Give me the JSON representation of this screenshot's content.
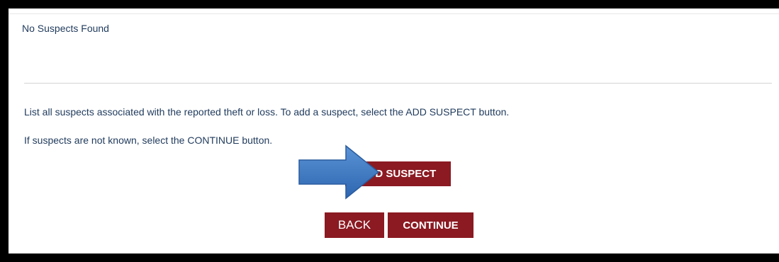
{
  "status": {
    "no_results_text": "No Suspects Found"
  },
  "instructions": {
    "line1": "List all suspects associated with the reported theft or loss. To add a suspect, select the ADD SUSPECT button.",
    "line2": "If suspects are not known, select the CONTINUE button."
  },
  "buttons": {
    "add_suspect": "ADD SUSPECT",
    "back": "BACK",
    "continue": "CONTINUE"
  },
  "colors": {
    "button_bg": "#8b1a22",
    "text": "#1f3a5c",
    "annotation_arrow": "#3d78c4"
  },
  "annotation": {
    "icon": "right-arrow-icon"
  }
}
